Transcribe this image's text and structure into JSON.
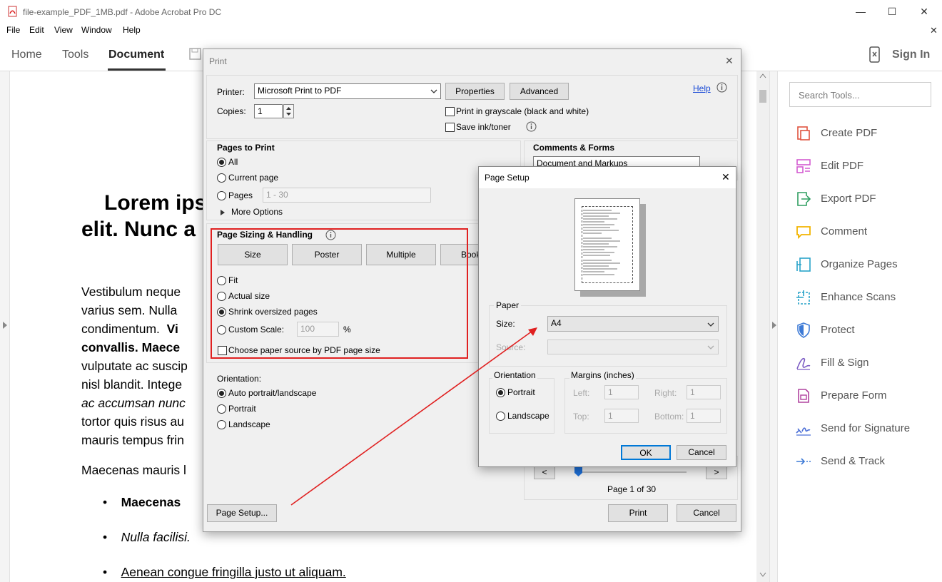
{
  "window": {
    "title": "file-example_PDF_1MB.pdf - Adobe Acrobat Pro DC",
    "minimize": "—",
    "maximize": "☐",
    "close": "✕",
    "doc_close": "✕"
  },
  "menu": [
    "File",
    "Edit",
    "View",
    "Window",
    "Help"
  ],
  "nav": {
    "tabs": [
      "Home",
      "Tools",
      "Document"
    ],
    "active": "Document",
    "sign_in": "Sign In"
  },
  "document": {
    "heading_line1": "Lorem ips",
    "heading_line2": "elit. Nunc a",
    "para1": [
      "Vestibulum neque",
      "varius sem. Nulla",
      "condimentum.",
      "convallis. Maece",
      "vulputate ac suscip",
      "nisl blandit. Intege",
      "ac accumsan nunc",
      "tortor quis risus au",
      "mauris tempus frin"
    ],
    "para1_bold_tail": "Vi",
    "para2": "Maecenas mauris l",
    "bullets": [
      "Maecenas",
      "Nulla facilisi.",
      "Aenean congue fringilla justo ut aliquam."
    ]
  },
  "tools_panel": {
    "search_placeholder": "Search Tools...",
    "items": [
      {
        "label": "Create PDF",
        "icon": "create-pdf-icon",
        "color": "#e0533f"
      },
      {
        "label": "Edit PDF",
        "icon": "edit-pdf-icon",
        "color": "#d35bd0"
      },
      {
        "label": "Export PDF",
        "icon": "export-pdf-icon",
        "color": "#2f9e61"
      },
      {
        "label": "Comment",
        "icon": "comment-icon",
        "color": "#f2b400"
      },
      {
        "label": "Organize Pages",
        "icon": "organize-pages-icon",
        "color": "#29a3c9"
      },
      {
        "label": "Enhance Scans",
        "icon": "enhance-scans-icon",
        "color": "#29a3c9"
      },
      {
        "label": "Protect",
        "icon": "protect-icon",
        "color": "#3d7ad6"
      },
      {
        "label": "Fill & Sign",
        "icon": "fill-sign-icon",
        "color": "#7c5cc4"
      },
      {
        "label": "Prepare Form",
        "icon": "prepare-form-icon",
        "color": "#b0439f"
      },
      {
        "label": "Send for Signature",
        "icon": "send-signature-icon",
        "color": "#4a6ed6"
      },
      {
        "label": "Send & Track",
        "icon": "send-track-icon",
        "color": "#3d7ad6"
      }
    ]
  },
  "print_dialog": {
    "title": "Print",
    "close": "✕",
    "printer_label": "Printer:",
    "printer_value": "Microsoft Print to PDF",
    "properties": "Properties",
    "advanced": "Advanced",
    "help": "Help",
    "copies_label": "Copies:",
    "copies_value": "1",
    "grayscale": "Print in grayscale (black and white)",
    "save_ink": "Save ink/toner",
    "pages_to_print": "Pages to Print",
    "all": "All",
    "current_page": "Current page",
    "pages": "Pages",
    "pages_range": "1 - 30",
    "more_options": "More Options",
    "sizing_title": "Page Sizing & Handling",
    "size_btn": "Size",
    "poster_btn": "Poster",
    "multiple_btn": "Multiple",
    "booklet_btn": "Book",
    "fit": "Fit",
    "actual_size": "Actual size",
    "shrink": "Shrink oversized pages",
    "custom_scale": "Custom Scale:",
    "custom_value": "100",
    "percent": "%",
    "paper_source": "Choose paper source by PDF page size",
    "orientation_title": "Orientation:",
    "auto_orient": "Auto portrait/landscape",
    "portrait": "Portrait",
    "landscape": "Landscape",
    "comments_forms": "Comments & Forms",
    "comments_value": "Document and Markups",
    "page_counter": "Page 1 of 30",
    "prev": "<",
    "next": ">",
    "page_setup": "Page Setup...",
    "print": "Print",
    "cancel": "Cancel"
  },
  "page_setup_dialog": {
    "title": "Page Setup",
    "close": "✕",
    "paper_group": "Paper",
    "size_label": "Size:",
    "size_value": "A4",
    "source_label": "Source:",
    "orientation_group": "Orientation",
    "portrait": "Portrait",
    "landscape": "Landscape",
    "margins_group": "Margins (inches)",
    "left_label": "Left:",
    "right_label": "Right:",
    "top_label": "Top:",
    "bottom_label": "Bottom:",
    "left_value": "1",
    "right_value": "1",
    "top_value": "1",
    "bottom_value": "1",
    "ok": "OK",
    "cancel": "Cancel"
  },
  "annotation": {
    "highlight_color": "#e02020"
  }
}
